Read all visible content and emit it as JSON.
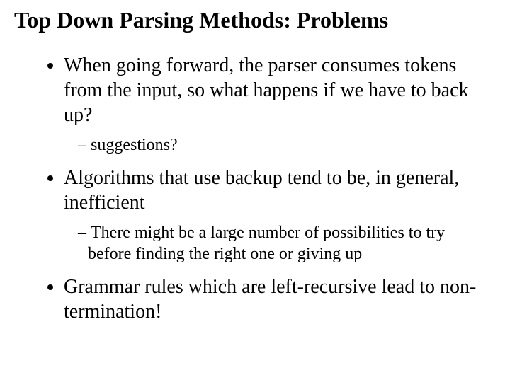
{
  "title": "Top Down Parsing Methods: Problems",
  "bullets": {
    "b1": {
      "text": "When going forward, the parser consumes tokens from the input, so what happens if we have to back up?",
      "sub1": "suggestions?"
    },
    "b2": {
      "text": "Algorithms that use backup tend to be, in general, inefficient",
      "sub1": "There might be a large number of possibilities to try before finding the right one or giving up"
    },
    "b3": {
      "text": "Grammar rules which are left-recursive lead to non-termination!"
    }
  }
}
